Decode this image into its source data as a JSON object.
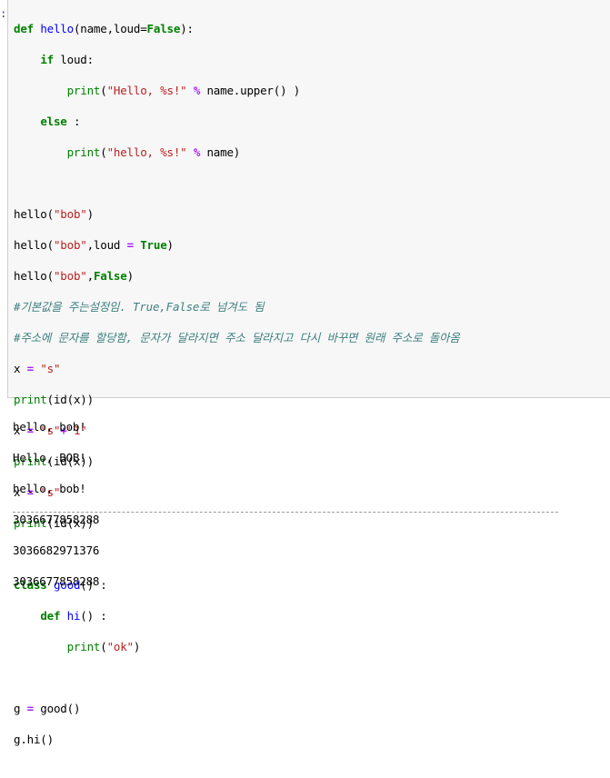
{
  "prompt_marker": ":",
  "code": {
    "l1": {
      "kw1": "def",
      "name": "hello",
      "args": "(name,loud=",
      "kw2": "False",
      "end": "):"
    },
    "l2": {
      "kw": "if",
      "rest": " loud:"
    },
    "l3": {
      "bi": "print",
      "p": "(",
      "str": "\"Hello, %s!\"",
      "op": " % ",
      "rest": "name.upper() )"
    },
    "l4": {
      "kw": "else",
      "rest": " :"
    },
    "l5": {
      "bi": "print",
      "p": "(",
      "str": "\"hello, %s!\"",
      "op": " % ",
      "rest": "name)"
    },
    "l6": {
      "a": "hello(",
      "str": "\"bob\"",
      "b": ")"
    },
    "l7": {
      "a": "hello(",
      "str": "\"bob\"",
      "b": ",loud ",
      "op": "=",
      "kw": " True",
      "c": ")"
    },
    "l8": {
      "a": "hello(",
      "str": "\"bob\"",
      "b": ",",
      "kw": "False",
      "c": ")"
    },
    "l9": {
      "cm": "#기본값을 주는설정임. True,False로 넘겨도 됨"
    },
    "l10": {
      "cm": "#주소에 문자를 할당함, 문자가 달라지면 주소 달라지고 다시 바꾸면 원래 주소로 돌아옴"
    },
    "l11": {
      "a": "x ",
      "op": "=",
      "sp": " ",
      "str": "\"s\""
    },
    "l12": {
      "bi": "print",
      "a": "(id(x))"
    },
    "l13": {
      "a": "x ",
      "op": "=",
      "sp": " ",
      "str1": "\"s\"",
      "op2": "+",
      "str2": "\"1\""
    },
    "l14": {
      "bi": "print",
      "a": "(id(x))"
    },
    "l15": {
      "a": "x ",
      "op": "=",
      "sp": " ",
      "str": "\"s\""
    },
    "l16": {
      "bi": "print",
      "a": "(id(x))"
    },
    "l17": {
      "kw": "class",
      "sp": " ",
      "name": "good",
      "rest": "() :"
    },
    "l18": {
      "kw": "def",
      "sp": " ",
      "name": "hi",
      "rest": "() :"
    },
    "l19": {
      "bi": "print",
      "p": "(",
      "str": "\"ok\"",
      "rest": ")"
    },
    "l20": {
      "a": "g ",
      "op": "=",
      "rest": " good()"
    },
    "l21": {
      "a": "g.hi()"
    }
  },
  "output_lines": [
    "hello, bob!",
    "Hello, BOB!",
    "hello, bob!",
    "3036677858288",
    "3036682971376",
    "3036677858288"
  ]
}
